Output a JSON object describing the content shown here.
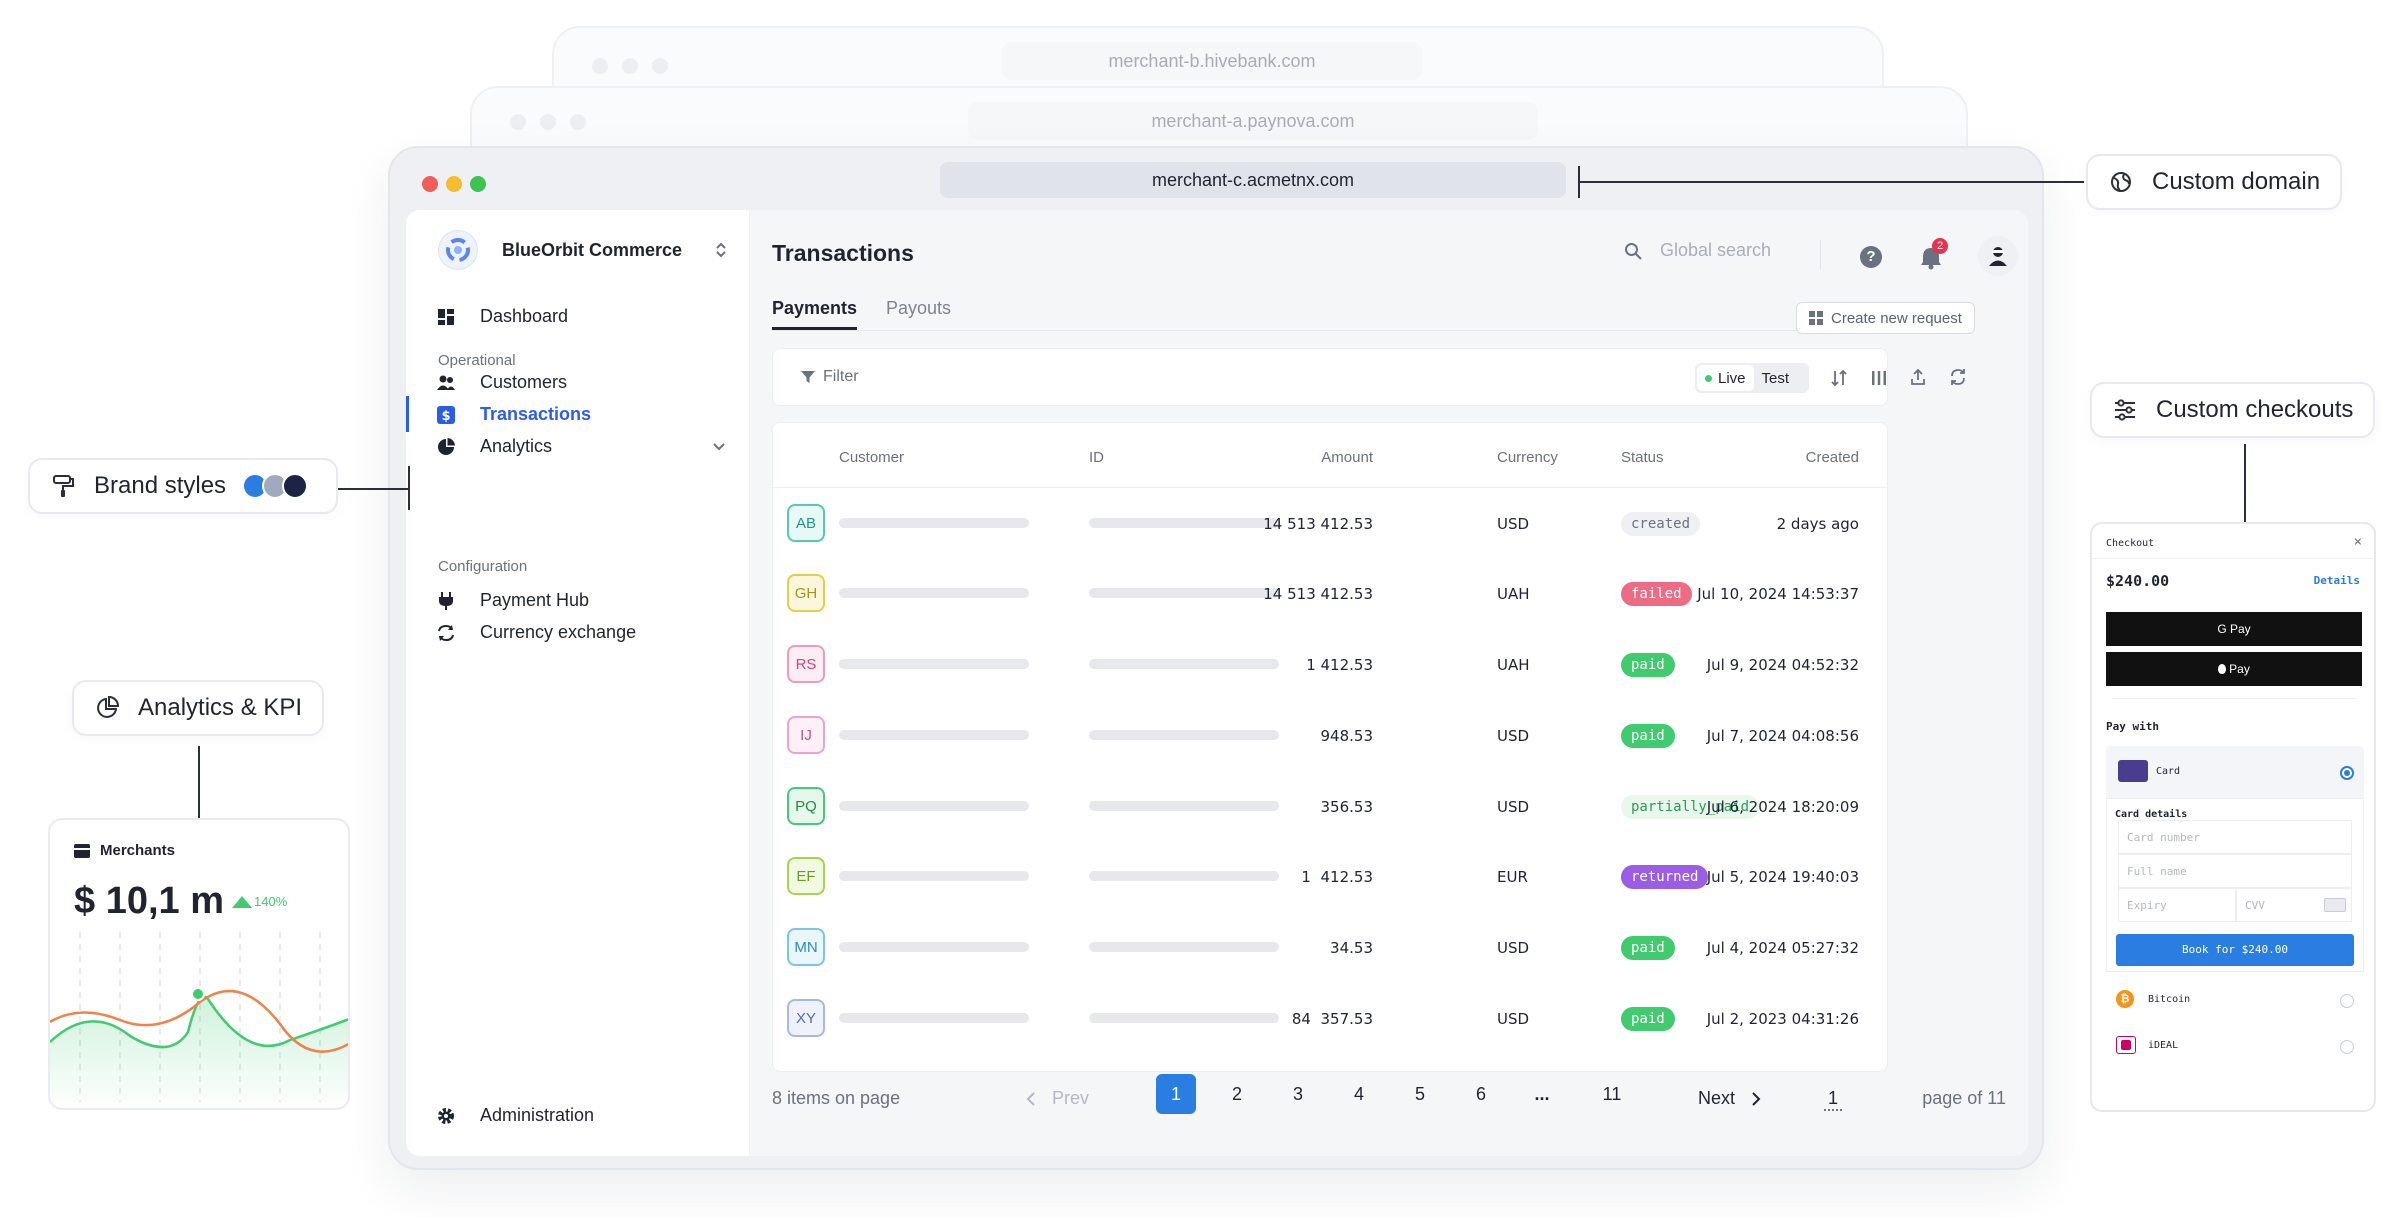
{
  "ghost_windows": [
    {
      "url": "merchant-b.hivebank.com"
    },
    {
      "url": "merchant-a.paynova.com"
    }
  ],
  "main_window": {
    "url": "merchant-c.acmetnx.com"
  },
  "sidebar": {
    "org_name": "BlueOrbit Commerce",
    "dashboard": "Dashboard",
    "section_operational": "Operational",
    "customers": "Customers",
    "transactions": "Transactions",
    "analytics": "Analytics",
    "section_configuration": "Configuration",
    "payment_hub": "Payment Hub",
    "currency_exchange": "Currency exchange",
    "administration": "Administration"
  },
  "header": {
    "title": "Transactions",
    "search_placeholder": "Global search",
    "notification_count": "2",
    "create_button": "Create new request"
  },
  "tabs": [
    "Payments",
    "Payouts"
  ],
  "toolbar": {
    "filter": "Filter",
    "live": "Live",
    "test": "Test"
  },
  "table": {
    "columns": [
      "Customer",
      "ID",
      "Amount",
      "Currency",
      "Status",
      "Created"
    ],
    "rows": [
      {
        "initials": "AB",
        "amount": "14 513 412.53",
        "currency": "USD",
        "status": "created",
        "created": "2 days ago"
      },
      {
        "initials": "GH",
        "amount": "14 513 412.53",
        "currency": "UAH",
        "status": "failed",
        "created": "Jul 10, 2024 14:53:37"
      },
      {
        "initials": "RS",
        "amount": "1 412.53",
        "currency": "UAH",
        "status": "paid",
        "created": "Jul 9, 2024 04:52:32"
      },
      {
        "initials": "IJ",
        "amount": "948.53",
        "currency": "USD",
        "status": "paid",
        "created": "Jul 7, 2024 04:08:56"
      },
      {
        "initials": "PQ",
        "amount": "356.53",
        "currency": "USD",
        "status": "partially_paid",
        "created": "Jul 6, 2024 18:20:09"
      },
      {
        "initials": "EF",
        "amount": "1  412.53",
        "currency": "EUR",
        "status": "returned",
        "created": "Jul 5, 2024 19:40:03"
      },
      {
        "initials": "MN",
        "amount": "34.53",
        "currency": "USD",
        "status": "paid",
        "created": "Jul 4, 2024 05:27:32"
      },
      {
        "initials": "XY",
        "amount": "84  357.53",
        "currency": "USD",
        "status": "paid",
        "created": "Jul 2, 2023 04:31:26"
      }
    ]
  },
  "pagination": {
    "items_on_page": "8 items on page",
    "prev": "Prev",
    "pages": [
      "1",
      "2",
      "3",
      "4",
      "5",
      "6",
      "...",
      "11"
    ],
    "current": "1",
    "next": "Next",
    "page_input": "1",
    "page_of": "page of 11"
  },
  "callouts": {
    "custom_domain": "Custom domain",
    "brand_styles": "Brand styles",
    "analytics_kpi": "Analytics & KPI",
    "custom_checkouts": "Custom checkouts"
  },
  "kpi_card": {
    "title": "Merchants",
    "value": "$ 10,1 m",
    "change": "140%"
  },
  "checkout": {
    "title": "Checkout",
    "amount": "$240.00",
    "details": "Details",
    "gpay": "G Pay",
    "applepay": "Pay",
    "pay_with": "Pay with",
    "card": "Card",
    "card_details": "Card details",
    "card_number": "Card number",
    "full_name": "Full name",
    "expiry": "Expiry",
    "cvv": "CVV",
    "book_button": "Book for $240.00",
    "bitcoin": "Bitcoin",
    "ideal": "iDEAL"
  },
  "colors": {
    "accent": "#2a5ee8",
    "paid": "#3fcb6e",
    "failed": "#ee6b85",
    "returned": "#9b5de5",
    "partially_paid_bg": "#e8f8ed",
    "created_bg": "#eef0f3"
  }
}
